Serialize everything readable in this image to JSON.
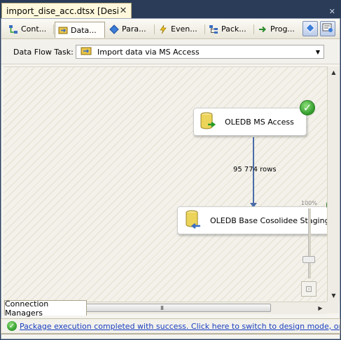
{
  "document_tab": {
    "title": "import_dise_acc.dtsx [Design]",
    "close": "✕"
  },
  "window_close": "✕",
  "designer_tabs": [
    {
      "label": "Cont...",
      "icon": "control-flow-icon"
    },
    {
      "label": "Data...",
      "icon": "data-flow-icon"
    },
    {
      "label": "Para...",
      "icon": "parameters-icon"
    },
    {
      "label": "Even...",
      "icon": "event-handlers-icon"
    },
    {
      "label": "Pack...",
      "icon": "package-explorer-icon"
    },
    {
      "label": "Prog...",
      "icon": "progress-icon"
    }
  ],
  "active_tab": "Data...",
  "task": {
    "label": "Data Flow Task:",
    "selected": "Import data via MS Access"
  },
  "components": {
    "source": {
      "label": "OLEDB MS Access",
      "status": "success"
    },
    "destination": {
      "label": "OLEDB Base Cosolidee Staging",
      "status": "success"
    }
  },
  "flow": {
    "rows": "95 774 rows"
  },
  "zoom": {
    "percent": "100%",
    "level": 1.0
  },
  "hscroll_grip": "III",
  "connection_managers": {
    "label": "Connection Managers"
  },
  "status": {
    "message": "Package execution completed with success. Click here to switch to design mode, or select S..."
  },
  "colors": {
    "accent": "#4a6ca8",
    "success": "#2f9a2a",
    "link": "#1a3fbf"
  }
}
